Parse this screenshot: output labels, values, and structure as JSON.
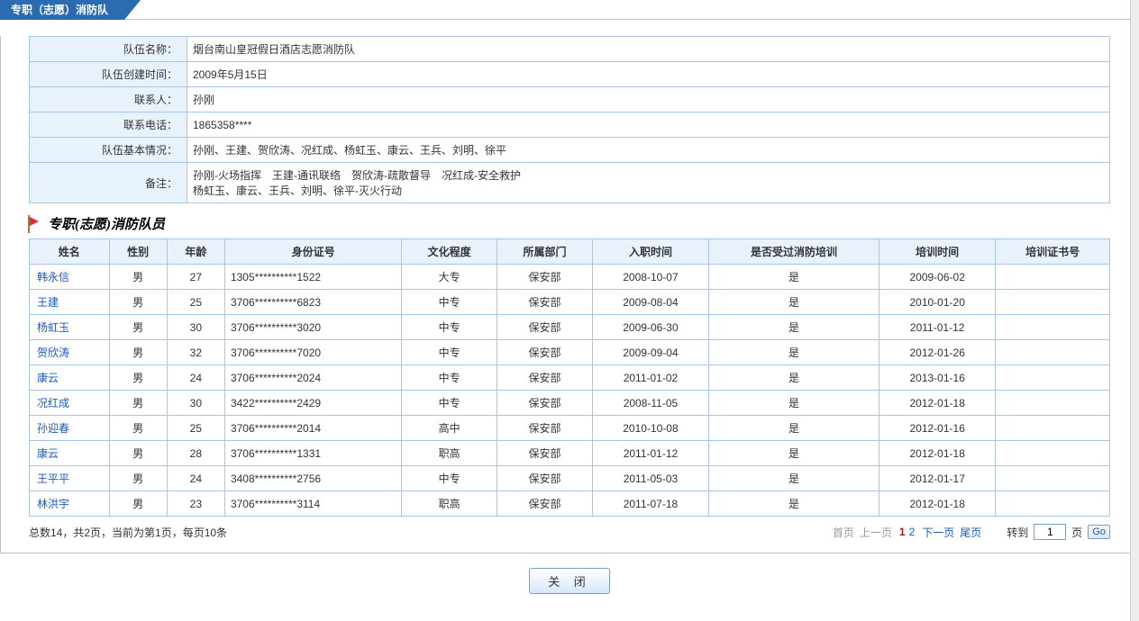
{
  "tab_title": "专职（志愿）消防队",
  "info": {
    "labels": {
      "team_name": "队伍名称：",
      "created": "队伍创建时间：",
      "contact": "联系人：",
      "phone": "联系电话：",
      "summary": "队伍基本情况：",
      "remark": "备注："
    },
    "values": {
      "team_name": "烟台南山皇冠假日酒店志愿消防队",
      "created": "2009年5月15日",
      "contact": "孙刚",
      "phone": "1865358****",
      "summary": "孙刚、王建、贺欣涛、况红成、杨虹玉、康云、王兵、刘明、徐平",
      "remark_line1": "孙刚-火场指挥　王建-通讯联络　贺欣涛-疏散督导　况红成-安全救护",
      "remark_line2": "杨虹玉、康云、王兵、刘明、徐平-灭火行动"
    }
  },
  "section_title": "专职(志愿)消防队员",
  "columns": [
    "姓名",
    "性别",
    "年龄",
    "身份证号",
    "文化程度",
    "所属部门",
    "入职时间",
    "是否受过消防培训",
    "培训时间",
    "培训证书号"
  ],
  "rows": [
    {
      "name": "韩永信",
      "gender": "男",
      "age": "27",
      "id": "1305**********1522",
      "edu": "大专",
      "dept": "保安部",
      "join": "2008-10-07",
      "trained": "是",
      "train_date": "2009-06-02",
      "cert": ""
    },
    {
      "name": "王建",
      "gender": "男",
      "age": "25",
      "id": "3706**********6823",
      "edu": "中专",
      "dept": "保安部",
      "join": "2009-08-04",
      "trained": "是",
      "train_date": "2010-01-20",
      "cert": ""
    },
    {
      "name": "杨虹玉",
      "gender": "男",
      "age": "30",
      "id": "3706**********3020",
      "edu": "中专",
      "dept": "保安部",
      "join": "2009-06-30",
      "trained": "是",
      "train_date": "2011-01-12",
      "cert": ""
    },
    {
      "name": "贺欣涛",
      "gender": "男",
      "age": "32",
      "id": "3706**********7020",
      "edu": "中专",
      "dept": "保安部",
      "join": "2009-09-04",
      "trained": "是",
      "train_date": "2012-01-26",
      "cert": ""
    },
    {
      "name": "康云",
      "gender": "男",
      "age": "24",
      "id": "3706**********2024",
      "edu": "中专",
      "dept": "保安部",
      "join": "2011-01-02",
      "trained": "是",
      "train_date": "2013-01-16",
      "cert": ""
    },
    {
      "name": "况红成",
      "gender": "男",
      "age": "30",
      "id": "3422**********2429",
      "edu": "中专",
      "dept": "保安部",
      "join": "2008-11-05",
      "trained": "是",
      "train_date": "2012-01-18",
      "cert": ""
    },
    {
      "name": "孙迎春",
      "gender": "男",
      "age": "25",
      "id": "3706**********2014",
      "edu": "高中",
      "dept": "保安部",
      "join": "2010-10-08",
      "trained": "是",
      "train_date": "2012-01-16",
      "cert": ""
    },
    {
      "name": "康云",
      "gender": "男",
      "age": "28",
      "id": "3706**********1331",
      "edu": "职高",
      "dept": "保安部",
      "join": "2011-01-12",
      "trained": "是",
      "train_date": "2012-01-18",
      "cert": ""
    },
    {
      "name": "王平平",
      "gender": "男",
      "age": "24",
      "id": "3408**********2756",
      "edu": "中专",
      "dept": "保安部",
      "join": "2011-05-03",
      "trained": "是",
      "train_date": "2012-01-17",
      "cert": ""
    },
    {
      "name": "林洪宇",
      "gender": "男",
      "age": "23",
      "id": "3706**********3114",
      "edu": "职高",
      "dept": "保安部",
      "join": "2011-07-18",
      "trained": "是",
      "train_date": "2012-01-18",
      "cert": ""
    }
  ],
  "pager": {
    "summary": "总数14，共2页，当前为第1页，每页10条",
    "first": "首页",
    "prev": "上一页",
    "pages": [
      "1",
      "2"
    ],
    "current_page": "1",
    "next": "下一页",
    "last": "尾页",
    "jump_label": "转到",
    "jump_value": "1",
    "jump_suffix": "页",
    "go_label": "Go"
  },
  "close_label": "关 闭"
}
